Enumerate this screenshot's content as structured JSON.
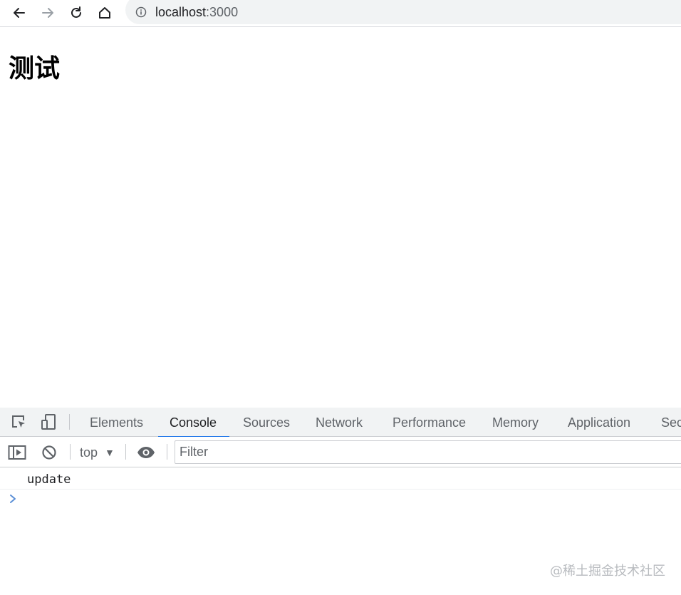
{
  "browser": {
    "url_host": "localhost",
    "url_port": ":3000"
  },
  "page": {
    "heading": "测试"
  },
  "devtools": {
    "tabs": [
      {
        "label": "Elements"
      },
      {
        "label": "Console"
      },
      {
        "label": "Sources"
      },
      {
        "label": "Network"
      },
      {
        "label": "Performance"
      },
      {
        "label": "Memory"
      },
      {
        "label": "Application"
      },
      {
        "label": "Sec"
      }
    ],
    "active_tab": "Console",
    "context": "top",
    "filter_placeholder": "Filter",
    "accent_color": "#1a73e8"
  },
  "console": {
    "messages": [
      {
        "text": "update"
      }
    ]
  },
  "watermark": "@稀土掘金技术社区"
}
